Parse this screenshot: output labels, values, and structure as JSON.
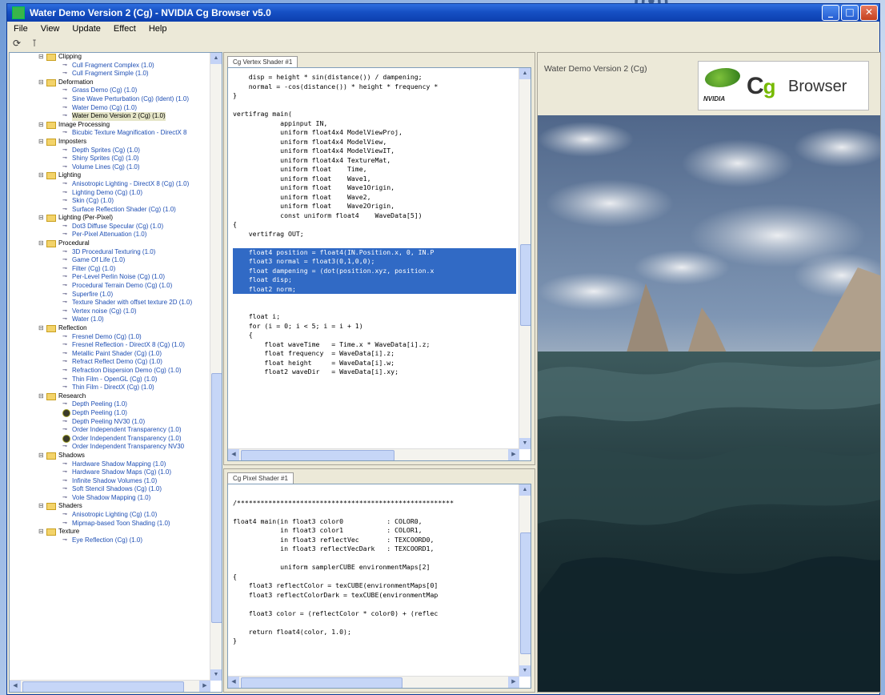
{
  "window": {
    "title": "Water Demo Version 2 (Cg) - NVIDIA Cg Browser v5.0",
    "controls": {
      "minimize": "_",
      "maximize": "□",
      "close": "✕"
    }
  },
  "desktop": {
    "logo_text": "((•))"
  },
  "menu": {
    "items": [
      "File",
      "View",
      "Update",
      "Effect",
      "Help"
    ]
  },
  "toolbar": {
    "icons": [
      "refresh-icon",
      "pin-icon"
    ]
  },
  "tree": {
    "rows": [
      {
        "type": "cat",
        "label": "Clipping"
      },
      {
        "type": "item",
        "label": "Cull Fragment Complex (1.0)"
      },
      {
        "type": "item",
        "label": "Cull Fragment Simple (1.0)"
      },
      {
        "type": "cat",
        "label": "Deformation"
      },
      {
        "type": "item",
        "label": "Grass Demo (Cg) (1.0)"
      },
      {
        "type": "item",
        "label": "Sine Wave Perturbation (Cg) (Ident) (1.0)"
      },
      {
        "type": "item",
        "label": "Water Demo (Cg) (1.0)"
      },
      {
        "type": "item",
        "label": "Water Demo Version 2 (Cg) (1.0)",
        "selected": true
      },
      {
        "type": "cat",
        "label": "Image Processing"
      },
      {
        "type": "item",
        "label": "Bicubic Texture Magnification - DirectX 8"
      },
      {
        "type": "cat",
        "label": "Imposters"
      },
      {
        "type": "item",
        "label": "Depth Sprites (Cg) (1.0)"
      },
      {
        "type": "item",
        "label": "Shiny Sprites (Cg) (1.0)"
      },
      {
        "type": "item",
        "label": "Volume Lines (Cg) (1.0)"
      },
      {
        "type": "cat",
        "label": "Lighting"
      },
      {
        "type": "item",
        "label": "Anisotropic Lighting - DirectX 8 (Cg) (1.0)"
      },
      {
        "type": "item",
        "label": "Lighting Demo (Cg) (1.0)"
      },
      {
        "type": "item",
        "label": "Skin (Cg) (1.0)"
      },
      {
        "type": "item",
        "label": "Surface Reflection Shader (Cg) (1.0)"
      },
      {
        "type": "cat",
        "label": "Lighting (Per-Pixel)"
      },
      {
        "type": "item",
        "label": "Dot3 Diffuse Specular (Cg) (1.0)"
      },
      {
        "type": "item",
        "label": "Per-Pixel Attenuation (1.0)"
      },
      {
        "type": "cat",
        "label": "Procedural"
      },
      {
        "type": "item",
        "label": "3D Procedural Texturing (1.0)"
      },
      {
        "type": "item",
        "label": "Game Of Life (1.0)"
      },
      {
        "type": "item",
        "label": "Filter (Cg) (1.0)"
      },
      {
        "type": "item",
        "label": "Per-Level Perlin Noise (Cg) (1.0)"
      },
      {
        "type": "item",
        "label": "Procedural Terrain Demo (Cg) (1.0)"
      },
      {
        "type": "item",
        "label": "Superfire (1.0)"
      },
      {
        "type": "item",
        "label": "Texture Shader with offset texture 2D (1.0)"
      },
      {
        "type": "item",
        "label": "Vertex noise (Cg) (1.0)"
      },
      {
        "type": "item",
        "label": "Water (1.0)"
      },
      {
        "type": "cat",
        "label": "Reflection"
      },
      {
        "type": "item",
        "label": "Fresnel Demo (Cg) (1.0)"
      },
      {
        "type": "item",
        "label": "Fresnel Reflection - DirectX 8 (Cg) (1.0)"
      },
      {
        "type": "item",
        "label": "Metallic Paint Shader (Cg) (1.0)"
      },
      {
        "type": "item",
        "label": "Refract Reflect Demo (Cg) (1.0)"
      },
      {
        "type": "item",
        "label": "Refraction Dispersion Demo (Cg) (1.0)"
      },
      {
        "type": "item",
        "label": "Thin Film - OpenGL (Cg) (1.0)"
      },
      {
        "type": "item",
        "label": "Thin Film - DirectX (Cg) (1.0)"
      },
      {
        "type": "cat",
        "label": "Research"
      },
      {
        "type": "item",
        "label": "Depth Peeling (1.0)"
      },
      {
        "type": "item",
        "label": "Depth Peeling (1.0)",
        "special": true
      },
      {
        "type": "item",
        "label": "Depth Peeling NV30 (1.0)"
      },
      {
        "type": "item",
        "label": "Order Independent Transparency (1.0)"
      },
      {
        "type": "item",
        "label": "Order Independent Transparency (1.0)",
        "special": true
      },
      {
        "type": "item",
        "label": "Order Independent Transparency NV30"
      },
      {
        "type": "cat",
        "label": "Shadows"
      },
      {
        "type": "item",
        "label": "Hardware Shadow Mapping (1.0)"
      },
      {
        "type": "item",
        "label": "Hardware Shadow Maps (Cg) (1.0)"
      },
      {
        "type": "item",
        "label": "Infinite Shadow Volumes (1.0)"
      },
      {
        "type": "item",
        "label": "Soft Stencil Shadows (Cg) (1.0)"
      },
      {
        "type": "item",
        "label": "Vole Shadow Mapping (1.0)"
      },
      {
        "type": "cat",
        "label": "Shaders"
      },
      {
        "type": "item",
        "label": "Anisotropic Lighting (Cg) (1.0)"
      },
      {
        "type": "item",
        "label": "Mipmap-based Toon Shading (1.0)"
      },
      {
        "type": "cat",
        "label": "Texture"
      },
      {
        "type": "item",
        "label": "Eye Reflection (Cg) (1.0)"
      }
    ]
  },
  "vertex_panel": {
    "tab": "Cg Vertex Shader #1",
    "lines": [
      "    disp = height * sin(distance()) / dampening;",
      "    normal = -cos(distance()) * height * frequency *",
      "}",
      "",
      "vertifrag main(",
      "            appinput IN,",
      "            uniform float4x4 ModelViewProj,",
      "            uniform float4x4 ModelView,",
      "            uniform float4x4 ModelViewIT,",
      "            uniform float4x4 TextureMat,",
      "            uniform float    Time,",
      "            uniform float    Wave1,",
      "            uniform float    Wave1Origin,",
      "            uniform float    Wave2,",
      "            uniform float    Wave2Origin,",
      "            const uniform float4    WaveData[5])",
      "{",
      "    vertifrag OUT;",
      "",
      "    float4 position = float4(IN.Position.x, 0, IN.P",
      "    float3 normal = float3(0,1,0,0);",
      "    float dampening = (dot(position.xyz, position.x",
      "    float disp;",
      "    float2 norm;",
      "",
      "",
      "    float i;",
      "    for (i = 0; i < 5; i = i + 1)",
      "    {",
      "        float waveTime   = Time.x * WaveData[i].z;",
      "        float frequency  = WaveData[i].z;",
      "        float height     = WaveData[i].w;",
      "        float2 waveDir   = WaveData[i].xy;"
    ],
    "highlighted": [
      19,
      20,
      21,
      22,
      23
    ]
  },
  "pixel_panel": {
    "tab": "Cg Pixel Shader #1",
    "lines": [
      "",
      "/*******************************************************",
      "",
      "float4 main(in float3 color0           : COLOR0,",
      "            in float3 color1           : COLOR1,",
      "            in float3 reflectVec       : TEXCOORD0,",
      "            in float3 reflectVecDark   : TEXCOORD1,",
      "",
      "            uniform samplerCUBE environmentMaps[2]",
      "{",
      "    float3 reflectColor = texCUBE(environmentMaps[0]",
      "    float3 reflectColorDark = texCUBE(environmentMap",
      "",
      "    float3 color = (reflectColor * color0) + (reflec",
      "",
      "    return float4(color, 1.0);",
      "}"
    ],
    "highlighted": []
  },
  "preview": {
    "title": "Water Demo Version 2 (Cg)",
    "logo": {
      "nvidia": "NVIDIA",
      "c": "C",
      "g": "g",
      "browser": "Browser"
    }
  }
}
